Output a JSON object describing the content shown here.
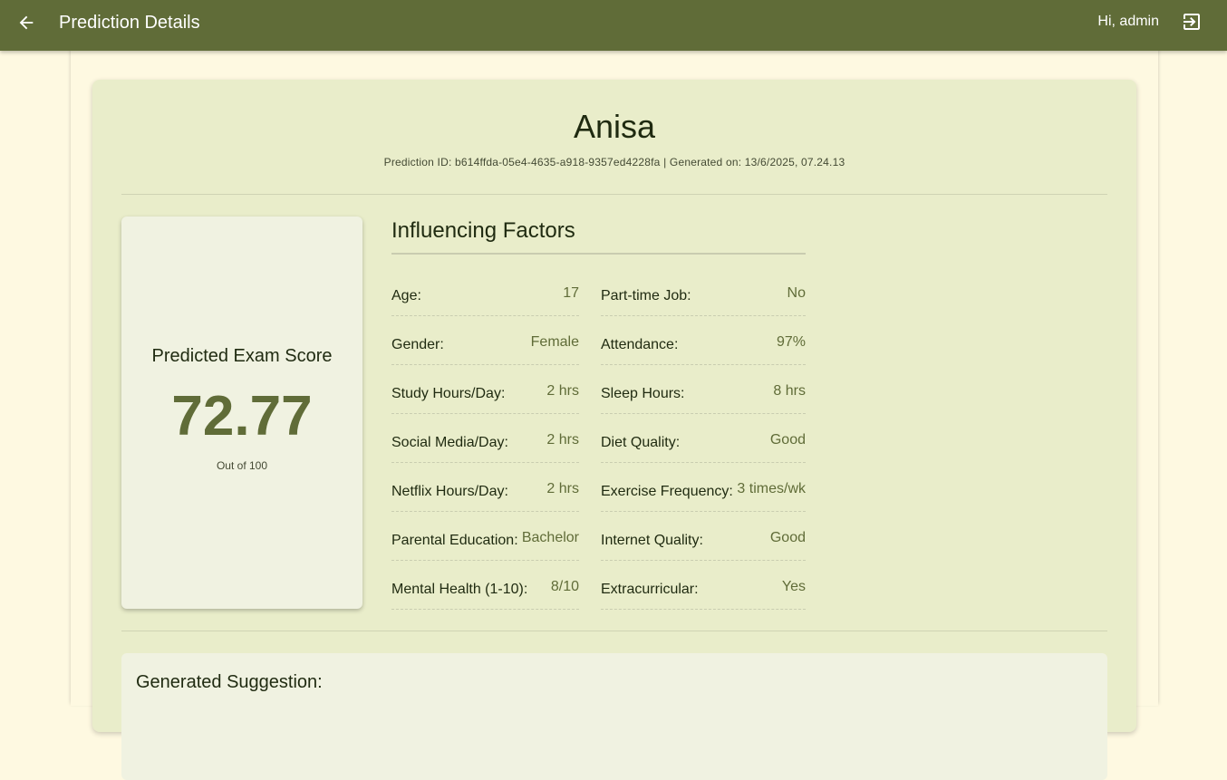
{
  "appbar": {
    "title": "Prediction Details",
    "greeting": "Hi, admin",
    "back_icon": "arrow-left-icon",
    "logout_icon": "logout-icon"
  },
  "student": {
    "name": "Anisa",
    "meta": "Prediction ID: b614ffda-05e4-4635-a918-9357ed4228fa | Generated on: 13/6/2025, 07.24.13"
  },
  "score": {
    "label": "Predicted Exam Score",
    "value": "72.77",
    "sub": "Out of 100"
  },
  "factors": {
    "title": "Influencing Factors",
    "left": [
      {
        "label": "Age:",
        "value": "17"
      },
      {
        "label": "Gender:",
        "value": "Female"
      },
      {
        "label": "Study Hours/Day:",
        "value": "2 hrs"
      },
      {
        "label": "Social Media/Day:",
        "value": "2 hrs"
      },
      {
        "label": "Netflix Hours/Day:",
        "value": "2 hrs"
      },
      {
        "label": "Parental Education:",
        "value": "Bachelor"
      },
      {
        "label": "Mental Health (1-10):",
        "value": "8/10"
      }
    ],
    "right": [
      {
        "label": "Part-time Job:",
        "value": "No"
      },
      {
        "label": "Attendance:",
        "value": "97%"
      },
      {
        "label": "Sleep Hours:",
        "value": "8 hrs"
      },
      {
        "label": "Diet Quality:",
        "value": "Good"
      },
      {
        "label": "Exercise Frequency:",
        "value": "3 times/wk"
      },
      {
        "label": "Internet Quality:",
        "value": "Good"
      },
      {
        "label": "Extracurricular:",
        "value": "Yes"
      }
    ]
  },
  "suggestion": {
    "title": "Generated Suggestion:"
  },
  "colors": {
    "appbar": "#606c38",
    "background": "#fef9e1",
    "card": "#e9edca",
    "accent": "#606c38"
  }
}
